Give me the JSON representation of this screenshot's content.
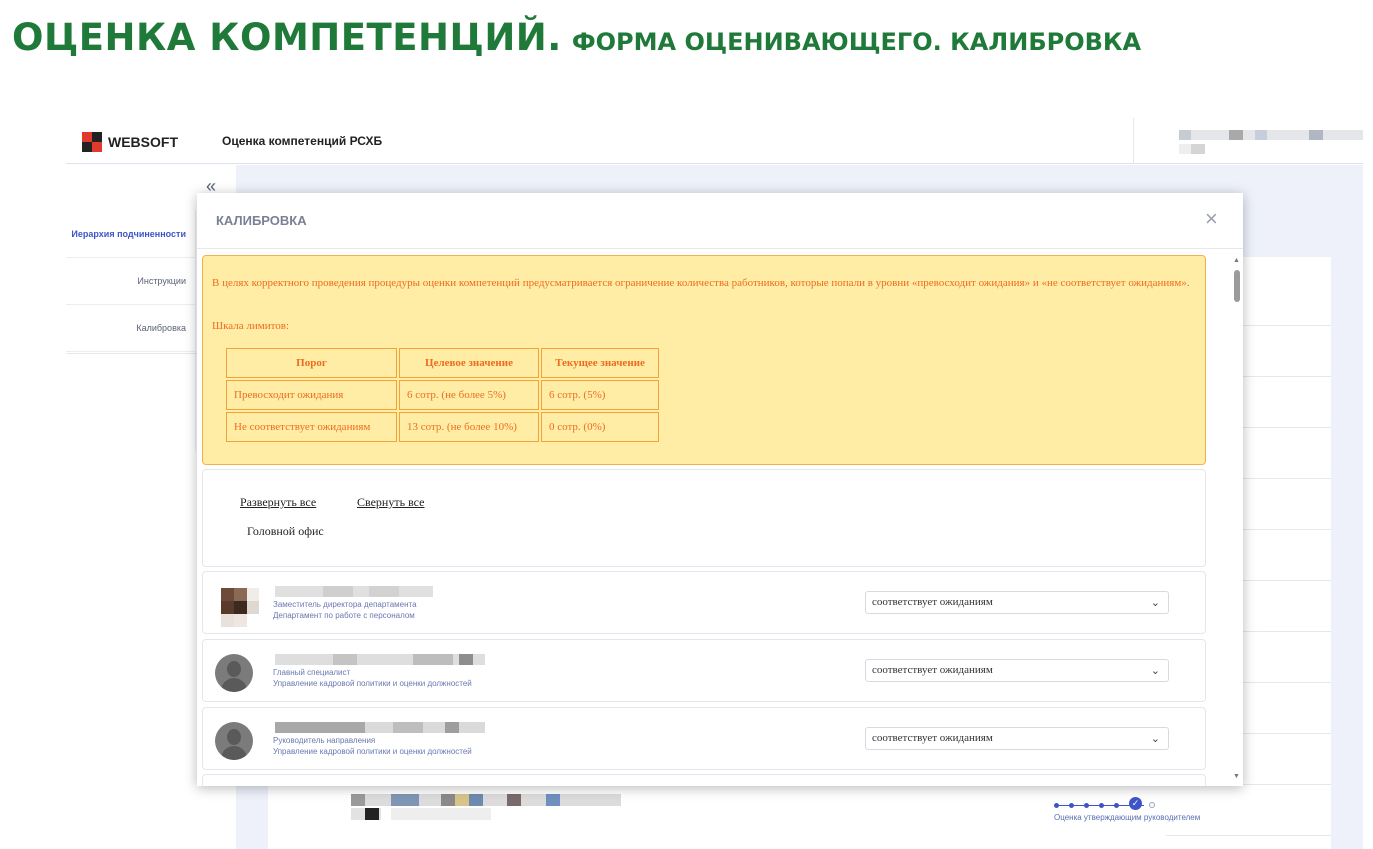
{
  "slide": {
    "title": "ОЦЕНКА КОМПЕТЕНЦИЙ.",
    "subtitle": "ФОРМА ОЦЕНИВАЮЩЕГО. КАЛИБРОВКА"
  },
  "app": {
    "brand": "WEBSOFT",
    "title": "Оценка компетенций РСХБ",
    "logo_colors": [
      "#e03a2f",
      "#222222",
      "#222222",
      "#e03a2f"
    ],
    "accent_color": "#3d55c8"
  },
  "sidebar": {
    "collapse_icon": "«",
    "items": [
      {
        "label": "Иерархия подчиненности",
        "active": true
      },
      {
        "label": "Инструкции",
        "active": false
      },
      {
        "label": "Калибровка",
        "active": false
      }
    ]
  },
  "background": {
    "stage_label": "Оценка утверждающим руководителем"
  },
  "modal": {
    "title": "КАЛИБРОВКА",
    "close_icon": "×",
    "alert": {
      "text": "В целях корректного проведения процедуры оценки компетенций предусматривается ограничение количества работников, которые попали в уровни «превосходит ожидания» и «не соответствует ожиданиям».",
      "scale_label": "Шкала лимитов:",
      "table": {
        "headers": [
          "Порог",
          "Целевое значение",
          "Текущее значение"
        ],
        "rows": [
          [
            "Превосходит ожидания",
            "6 сотр. (не более 5%)",
            "6 сотр. (5%)"
          ],
          [
            "Не соответствует ожиданиям",
            "13 сотр. (не более 10%)",
            "0 сотр. (0%)"
          ]
        ]
      },
      "colors": {
        "background": "#ffeda6",
        "border": "#f2b24a",
        "text": "#ef6c1f"
      }
    },
    "tree": {
      "expand_all": "Развернуть все",
      "collapse_all": "Свернуть все",
      "office": "Головной офис"
    },
    "employees": [
      {
        "position": "Заместитель директора департамента",
        "department": "Департамент по работе с персоналом",
        "rating": "соответствует ожиданиям"
      },
      {
        "position": "Главный специалист",
        "department": "Управление кадровой политики и оценки должностей",
        "rating": "соответствует ожиданиям"
      },
      {
        "position": "Руководитель направления",
        "department": "Управление кадровой политики и оценки должностей",
        "rating": "соответствует ожиданиям"
      }
    ],
    "select_icon": "chevron-down"
  }
}
